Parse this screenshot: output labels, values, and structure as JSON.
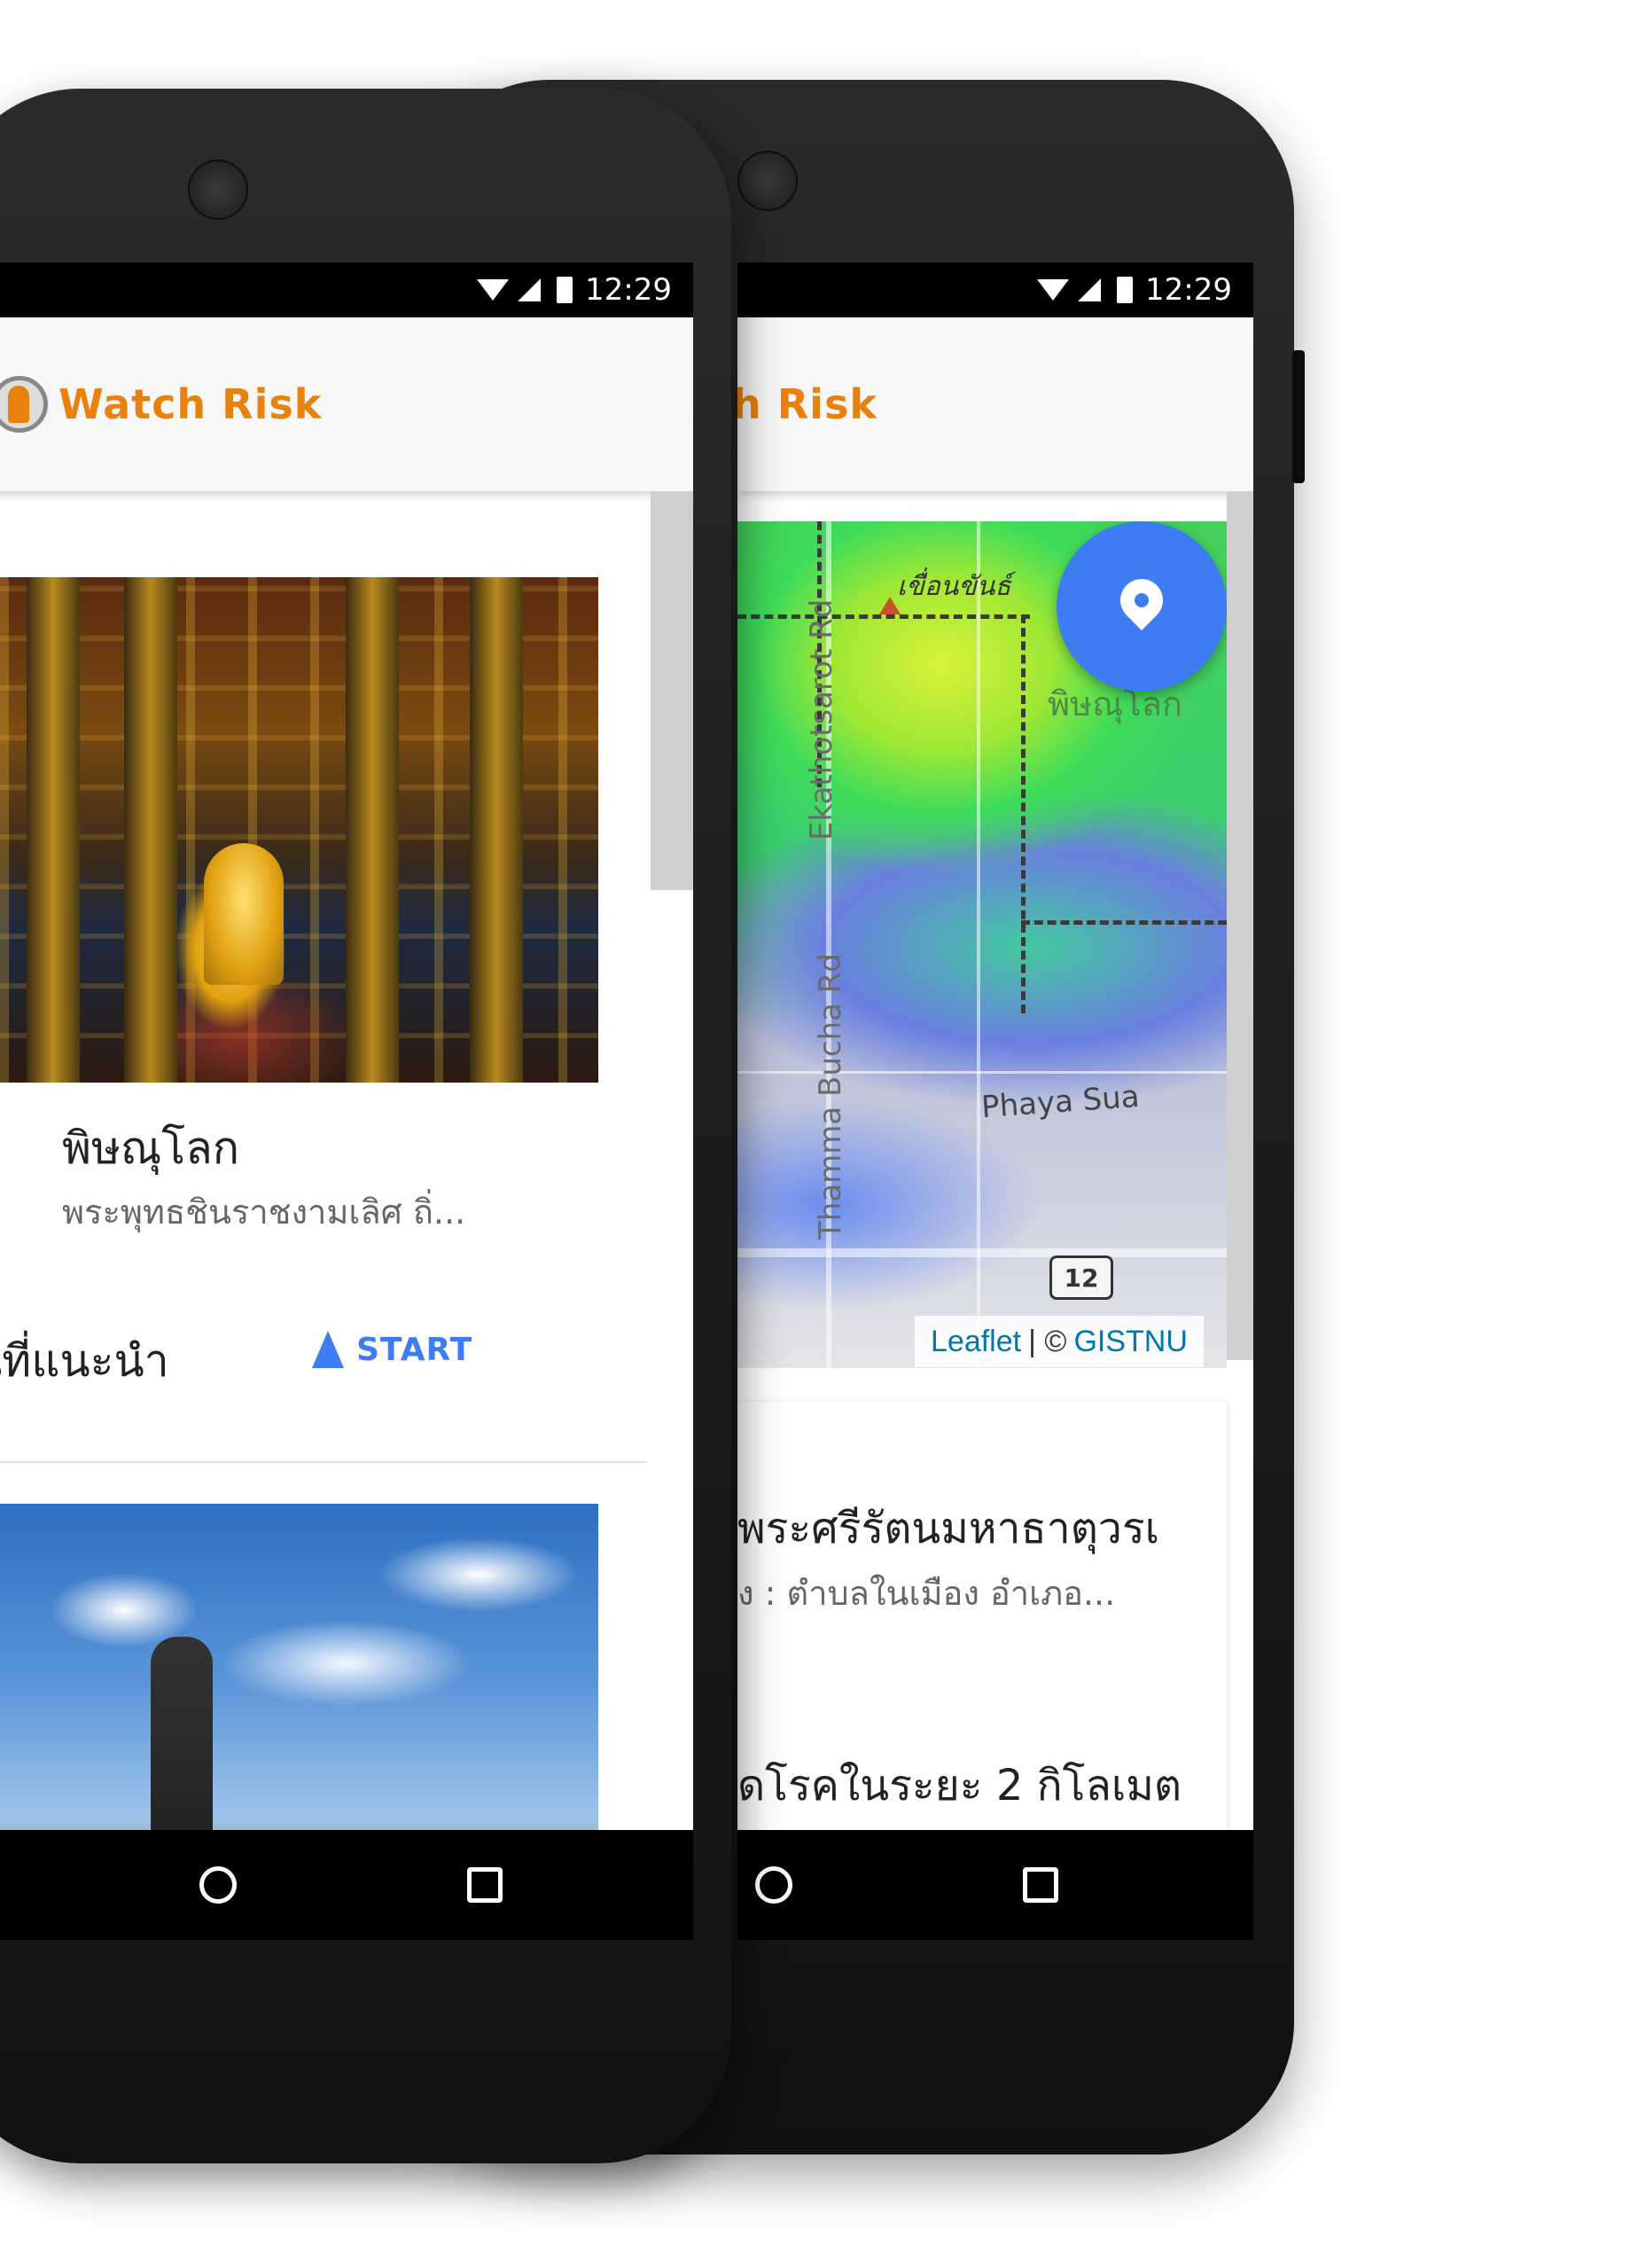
{
  "status": {
    "time": "12:29"
  },
  "app": {
    "name": "Watch Risk",
    "brand_color": "#e8820c"
  },
  "front": {
    "card": {
      "title": "พิษณุโลก",
      "subtitle": "พระพุทธชินราชงามเลิศ ถิ่..."
    },
    "section_title": "านที่แนะนำ",
    "start_label": "START"
  },
  "back": {
    "app_name_partial": "h Risk",
    "map": {
      "labels": {
        "road1": "Ekathotsarot Rd",
        "road2": "Thamma Bucha Rd",
        "area": "Phaya Sua",
        "landmark": "เขื่อนขันธ์",
        "district": "พิษณุโลก",
        "route": "12"
      },
      "attribution": {
        "leaflet": "Leaflet",
        "sep": " | © ",
        "provider": "GISTNU"
      }
    },
    "card": {
      "title": "พระศรีรัตนมหาธาตุวรเ",
      "subtitle": "ง : ตำบลในเมือง อำเภอ...",
      "risk_text": "ัดโรคในระยะ 2 กิโลเมต"
    }
  },
  "colors": {
    "accent": "#3d7cf2"
  }
}
